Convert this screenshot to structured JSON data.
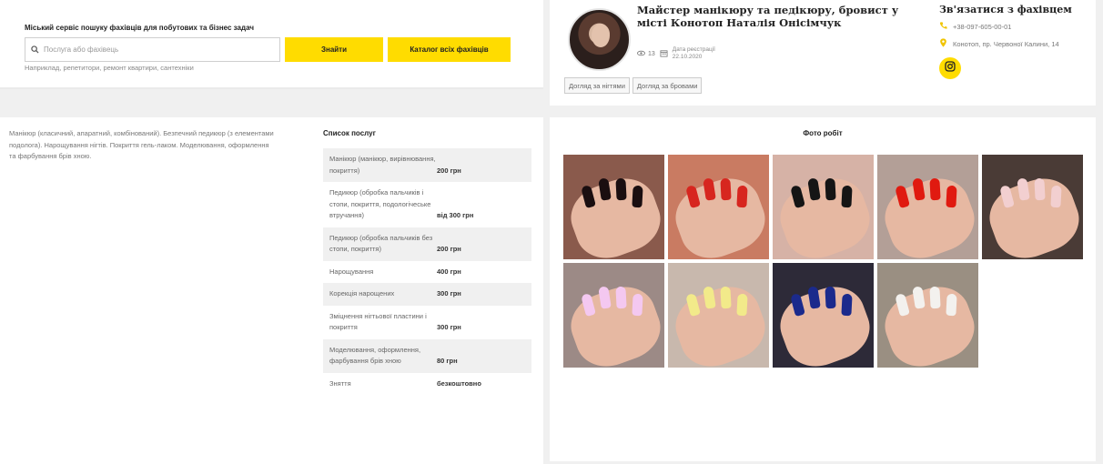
{
  "search": {
    "title": "Міський сервіс пошуку фахівців для побутових та бізнес задач",
    "placeholder": "Послуга або фахівець",
    "find_label": "Знайти",
    "catalog_label": "Каталог всіх фахівців",
    "hint": "Наприклад, репетитори, ремонт квартири, сантехніки",
    "icon": "search-icon"
  },
  "profile": {
    "name": "Майстер манікюру та педікюру, бровист у місті Конотоп Наталія Онісімчук",
    "views": "13",
    "reg_label": "Дата реєстрації",
    "reg_date": "22.10.2020",
    "tags": [
      "Догляд за нігтями",
      "Догляд за бровами"
    ]
  },
  "contact": {
    "title": "Зв'язатися з фахівцем",
    "phone": "+38-097-605-00-01",
    "address": "Конотоп, пр. Червоної Калини, 14",
    "instagram_icon": "instagram-icon",
    "accent": "#ffdc00"
  },
  "description": "Манікюр (класичний, апаратний, комбінований). Безпечний педикюр (з елементами подолога). Нарощування нігтів. Покриття гель-лаком. Моделювання, оформлення та фарбування брів хною.",
  "services": {
    "title": "Список послуг",
    "items": [
      {
        "name": "Манікюр (манікюр, вирівнювання, покриття)",
        "price": "200 грн"
      },
      {
        "name": "Педикюр (обробка пальчиків і стопи, покриття, подологічеське втручання)",
        "price": "від 300 грн"
      },
      {
        "name": "Педикюр (обробка пальчиків без стопи, покриття)",
        "price": "200 грн"
      },
      {
        "name": "Нарощування",
        "price": "400 грн"
      },
      {
        "name": "Корекція нарощених",
        "price": "300 грн"
      },
      {
        "name": "Зміцнення нігтьової пластини і покриття",
        "price": "300 грн"
      },
      {
        "name": "Моделювання, оформлення, фарбування брів хною",
        "price": "80 грн"
      },
      {
        "name": "Зняття",
        "price": "безкоштовно"
      }
    ]
  },
  "photos": {
    "title": "Фото робіт",
    "items": [
      {
        "bg": "#8a5a4c",
        "nail": "#1a0e10"
      },
      {
        "bg": "#c97b62",
        "nail": "#d7261f"
      },
      {
        "bg": "#d6b2a6",
        "nail": "#151515"
      },
      {
        "bg": "#b39f97",
        "nail": "#e01a10"
      },
      {
        "bg": "#4a3b36",
        "nail": "#f2cfd0"
      },
      {
        "bg": "#9c8a86",
        "nail": "#f4c8f0"
      },
      {
        "bg": "#c8b8ad",
        "nail": "#f2ea8a"
      },
      {
        "bg": "#2d2a38",
        "nail": "#1b2a8c"
      },
      {
        "bg": "#9a8f82",
        "nail": "#f3f1ee"
      }
    ]
  }
}
